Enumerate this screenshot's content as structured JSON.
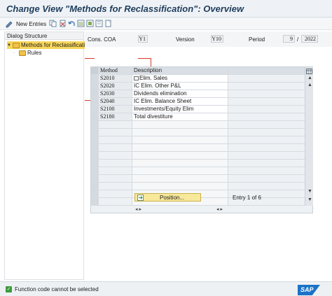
{
  "window": {
    "title": "Change View \"Methods for Reclassification\": Overview"
  },
  "toolbar": {
    "new_entries_label": "New Entries"
  },
  "tree": {
    "header": "Dialog Structure",
    "items": [
      {
        "label": "Methods for Reclassification",
        "selected": true
      },
      {
        "label": "Rules",
        "selected": false
      }
    ]
  },
  "filters": {
    "cons_coa_label": "Cons. COA",
    "cons_coa_value": "Y1",
    "version_label": "Version",
    "version_value": "Y10",
    "period_label": "Period",
    "period_value": "9",
    "period_sep": "/",
    "year_value": "2022"
  },
  "table": {
    "columns": [
      "Method",
      "Description"
    ],
    "rows": [
      {
        "method": "S2010",
        "description": "Elim. Sales"
      },
      {
        "method": "S2020",
        "description": "IC Elim. Other P&L"
      },
      {
        "method": "S2030",
        "description": "Dividends elimination"
      },
      {
        "method": "S2040",
        "description": "IC Elim. Balance Sheet"
      },
      {
        "method": "S2100",
        "description": "Investments/Equity Elim"
      },
      {
        "method": "S2180",
        "description": "Total divestiture"
      }
    ]
  },
  "position_button": {
    "label": "Position..."
  },
  "entry_info": "Entry 1 of 6",
  "status": {
    "message": "Function code cannot be selected"
  },
  "brand": {
    "logo_text": "SAP",
    "accent": "#1b73c7"
  }
}
